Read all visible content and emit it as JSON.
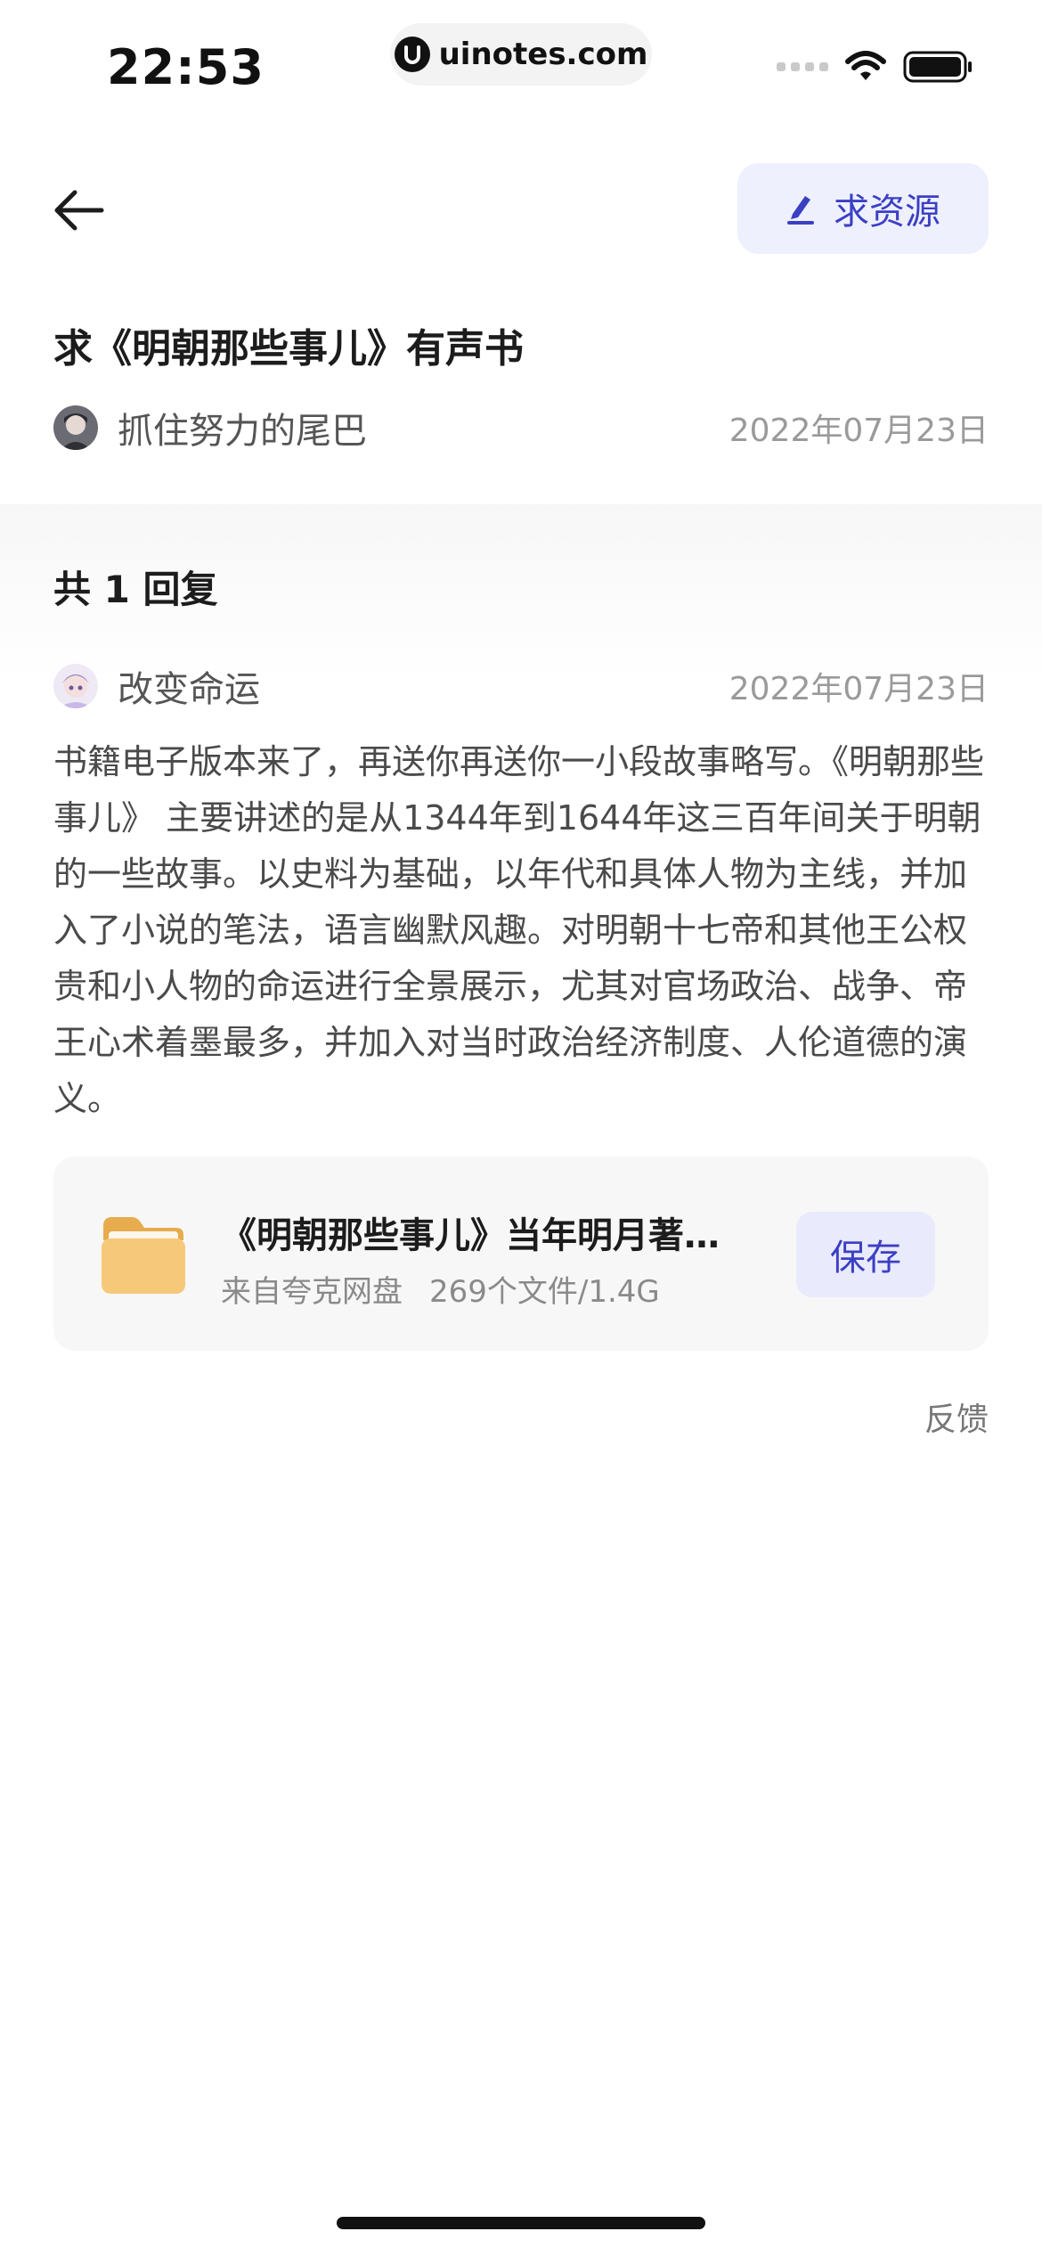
{
  "status_bar": {
    "time": "22:53",
    "url": "uinotes.com"
  },
  "header": {
    "request_button_label": "求资源"
  },
  "post": {
    "title": "求《明朝那些事儿》有声书",
    "author": "抓住努力的尾巴",
    "date": "2022年07月23日"
  },
  "replies": {
    "count_label": "共 1 回复",
    "items": [
      {
        "author": "改变命运",
        "date": "2022年07月23日",
        "body": "书籍电子版本来了，再送你再送你一小段故事略写。《明朝那些事儿》 主要讲述的是从1344年到1644年这三百年间关于明朝的一些故事。以史料为基础，以年代和具体人物为主线，并加入了小说的笔法，语言幽默风趣。对明朝十七帝和其他王公权贵和小人物的命运进行全景展示，尤其对官场政治、战争、帝王心术着墨最多，并加入对当时政治经济制度、人伦道德的演义。",
        "file": {
          "name": "《明朝那些事儿》当年明月著（全套）",
          "source": "来自夸克网盘",
          "stats": "269个文件/1.4G",
          "save_label": "保存"
        },
        "feedback_label": "反馈"
      }
    ]
  },
  "colors": {
    "accent": "#3b3fc4",
    "accent_bg": "#eef0fd",
    "folder": "#f6c97a"
  },
  "icons": {
    "back": "arrow-left-icon",
    "request": "pen-icon",
    "folder": "folder-icon"
  }
}
